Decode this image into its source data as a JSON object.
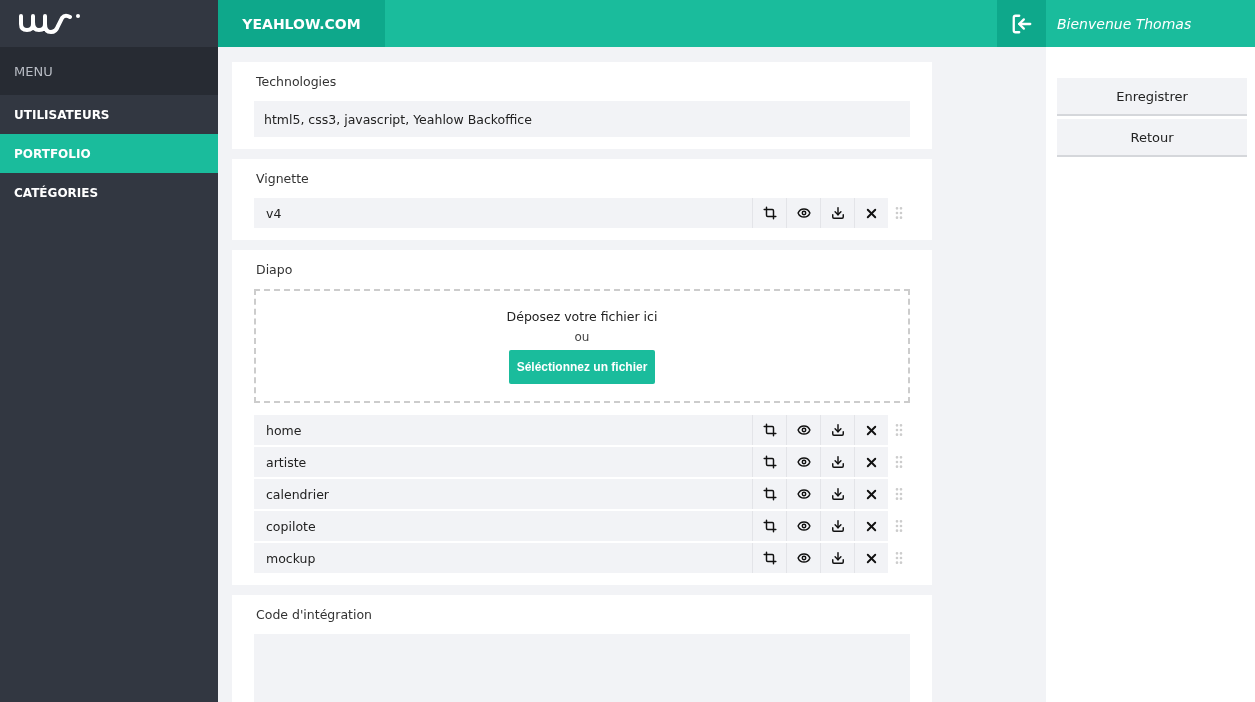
{
  "brand": {
    "site": "YEAHLOW.COM",
    "welcome": "Bienvenue Thomas"
  },
  "menu": {
    "title": "MENU",
    "items": [
      {
        "label": "UTILISATEURS",
        "selected": false
      },
      {
        "label": "PORTFOLIO",
        "selected": true
      },
      {
        "label": "CATÉGORIES",
        "selected": false
      }
    ]
  },
  "sections": [
    {
      "kind": "text",
      "label": "Technologies",
      "value": "html5, css3, javascript, Yeahlow Backoffice"
    },
    {
      "kind": "files",
      "label": "Vignette",
      "files": [
        "v4"
      ]
    },
    {
      "kind": "upload",
      "label": "Diapo",
      "drop_text": "Déposez votre fichier ici",
      "or_text": "ou",
      "button": "Séléctionnez un fichier",
      "files": [
        "home",
        "artiste",
        "calendrier",
        "copilote",
        "mockup"
      ]
    },
    {
      "kind": "textarea",
      "label": "Code d'intégration"
    }
  ],
  "actions": [
    "Enregistrer",
    "Retour"
  ]
}
